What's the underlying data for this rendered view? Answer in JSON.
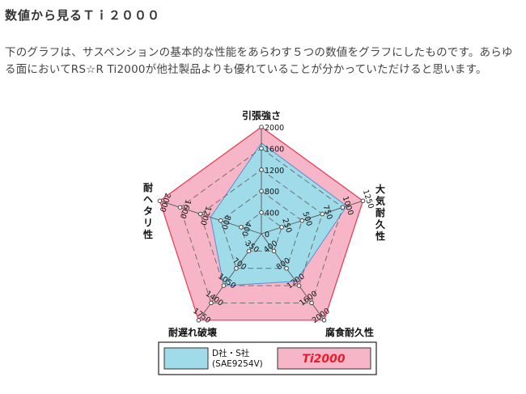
{
  "page": {
    "title": "数値から見るＴｉ２０００",
    "description": "下のグラフは、サスペンションの基本的な性能をあらわす５つの数値をグラフにしたものです。あらゆる面においてRS☆R Ti2000が他社製品よりも優れていることが分かっていただけると思います。"
  },
  "chart_data": {
    "type": "radar",
    "axes": [
      {
        "label": "引張強さ",
        "ticks": [
          "0",
          "400",
          "800",
          "1200",
          "1600",
          "2000"
        ],
        "max": 2000
      },
      {
        "label": "大気耐久性",
        "ticks": [
          "0",
          "250",
          "500",
          "750",
          "1000",
          "1250"
        ],
        "max": 1250
      },
      {
        "label": "腐食耐久性",
        "ticks": [
          "0",
          "400",
          "800",
          "1200",
          "1600",
          "2000"
        ],
        "max": 2000
      },
      {
        "label": "耐遅れ破壊",
        "ticks": [
          "0",
          "350",
          "700",
          "1050",
          "1400",
          "1750"
        ],
        "max": 1750
      },
      {
        "label": "耐ヘタリ性",
        "ticks": [
          "0",
          "400",
          "800",
          "1200",
          "1600",
          "2000"
        ],
        "max": 2000
      }
    ],
    "series": [
      {
        "name": "Ti2000",
        "values": [
          2000,
          1250,
          2000,
          1750,
          2000
        ],
        "color": "#f7b6c8",
        "stroke": "#e8374e"
      },
      {
        "name": "D社・S社 (SAE9254V)",
        "values": [
          1700,
          1050,
          1100,
          1050,
          1000
        ],
        "color": "#9fdbe8",
        "stroke": "#5a8fcf"
      }
    ],
    "legend": {
      "position": "bottom",
      "items": [
        {
          "line1": "D社・S社",
          "line2": "(SAE9254V)",
          "color": "#9fdbe8"
        },
        {
          "logo": "Ti2000",
          "color": "#f7b6c8"
        }
      ]
    }
  }
}
